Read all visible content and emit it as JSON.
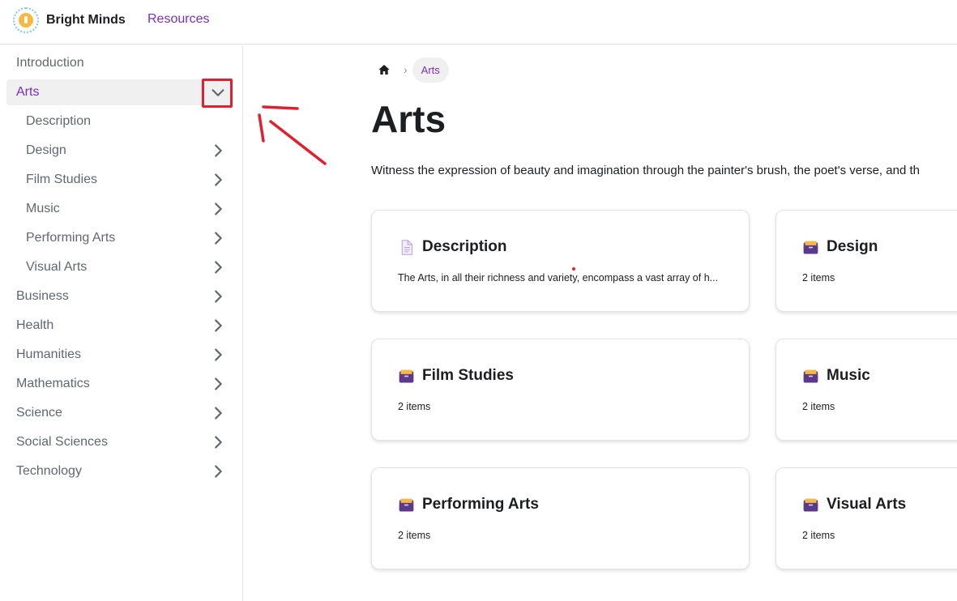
{
  "brand": {
    "name": "Bright Minds",
    "logo_icon": "bright-minds-logo"
  },
  "navbar": {
    "resources_label": "Resources"
  },
  "colors": {
    "accent": "#7a2ec4",
    "highlight": "#e0202e",
    "folder_icon": "#5b3a8c",
    "folder_tab": "#f5b942"
  },
  "sidebar": {
    "items": [
      {
        "label": "Introduction",
        "has_chevron": false
      },
      {
        "label": "Arts",
        "active": true,
        "expanded": true,
        "chevron": "chevron-down"
      },
      {
        "label": "Description",
        "sub": true,
        "has_chevron": false
      },
      {
        "label": "Design",
        "sub": true,
        "chevron": "chevron-right"
      },
      {
        "label": "Film Studies",
        "sub": true,
        "chevron": "chevron-right"
      },
      {
        "label": "Music",
        "sub": true,
        "chevron": "chevron-right"
      },
      {
        "label": "Performing Arts",
        "sub": true,
        "chevron": "chevron-right"
      },
      {
        "label": "Visual Arts",
        "sub": true,
        "chevron": "chevron-right"
      },
      {
        "label": "Business",
        "chevron": "chevron-right"
      },
      {
        "label": "Health",
        "chevron": "chevron-right"
      },
      {
        "label": "Humanities",
        "chevron": "chevron-right"
      },
      {
        "label": "Mathematics",
        "chevron": "chevron-right"
      },
      {
        "label": "Science",
        "chevron": "chevron-right"
      },
      {
        "label": "Social Sciences",
        "chevron": "chevron-right"
      },
      {
        "label": "Technology",
        "chevron": "chevron-right"
      }
    ]
  },
  "breadcrumb": {
    "home_icon": "home-icon",
    "separator": "›",
    "current": "Arts"
  },
  "main": {
    "title": "Arts",
    "description": "Witness the expression of beauty and imagination through the painter's brush, the poet's verse, and th",
    "cards": [
      {
        "title": "Description",
        "subtitle": "The Arts, in all their richness and variety, encompass a vast array of h...",
        "icon": "document-icon"
      },
      {
        "title": "Design",
        "subtitle": "2 items",
        "icon": "folder-icon"
      },
      {
        "title": "Film Studies",
        "subtitle": "2 items",
        "icon": "folder-icon"
      },
      {
        "title": "Music",
        "subtitle": "2 items",
        "icon": "folder-icon"
      },
      {
        "title": "Performing Arts",
        "subtitle": "2 items",
        "icon": "folder-icon"
      },
      {
        "title": "Visual Arts",
        "subtitle": "2 items",
        "icon": "folder-icon"
      }
    ]
  }
}
